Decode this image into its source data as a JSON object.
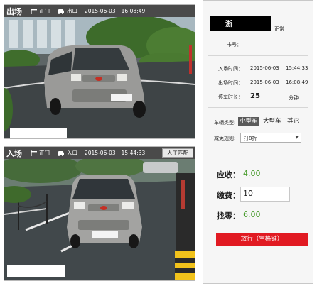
{
  "exit_panel": {
    "title": "出场",
    "gate": "正门",
    "direction": "出口",
    "date": "2015-06-03",
    "time": "16:08:49"
  },
  "entry_panel": {
    "title": "入场",
    "gate": "正门",
    "direction": "入口",
    "date": "2015-06-03",
    "time": "15:44:33",
    "manual_match_label": "人工匹配"
  },
  "info": {
    "plate_prefix": "浙",
    "plate_status": "正常",
    "card_label": "卡号：",
    "card_value": "",
    "entry_time_label": "入场时间：",
    "entry_date": "2015-06-03",
    "entry_time": "15:44:33",
    "exit_time_label": "出场时间：",
    "exit_date": "2015-06-03",
    "exit_time": "16:08:49",
    "duration_label": "停车时长：",
    "duration_value": "25",
    "duration_unit": "分钟",
    "vehicle_type_label": "车辆类型:",
    "vehicle_types": [
      "小型车",
      "大型车",
      "其它"
    ],
    "discount_label": "减免规则:",
    "discount_value": "打8折"
  },
  "fees": {
    "receivable_label": "应收：",
    "receivable_value": "4.00",
    "paid_label": "缴费：",
    "paid_value": "10",
    "change_label": "找零：",
    "change_value": "6.00"
  },
  "release_button_label": "放行（空格键）",
  "colors": {
    "accent_green": "#4a9d2f",
    "release_red": "#e11a22",
    "title_bar": "#4a4a4a"
  }
}
